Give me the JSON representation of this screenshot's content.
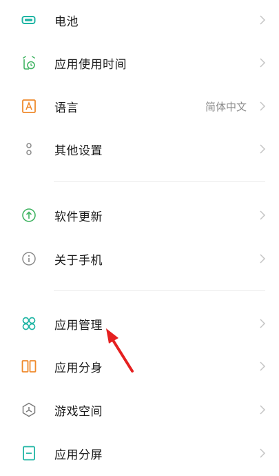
{
  "items": [
    {
      "label": "电池",
      "icon": "battery-icon"
    },
    {
      "label": "应用使用时间",
      "icon": "alarm-clock-icon"
    },
    {
      "label": "语言",
      "value": "简体中文",
      "icon": "language-a-icon"
    },
    {
      "label": "其他设置",
      "icon": "more-dots-icon"
    },
    {
      "label": "软件更新",
      "icon": "update-arrow-icon"
    },
    {
      "label": "关于手机",
      "icon": "info-icon"
    },
    {
      "label": "应用管理",
      "icon": "app-grid-icon"
    },
    {
      "label": "应用分身",
      "icon": "app-clone-icon"
    },
    {
      "label": "游戏空间",
      "icon": "game-space-icon"
    },
    {
      "label": "应用分屏",
      "icon": "split-screen-icon"
    }
  ],
  "colors": {
    "teal": "#1fb5a4",
    "green": "#41b463",
    "orange": "#ef8a2c",
    "gray": "#8a8a8a",
    "annotation_arrow": "#e52020"
  }
}
